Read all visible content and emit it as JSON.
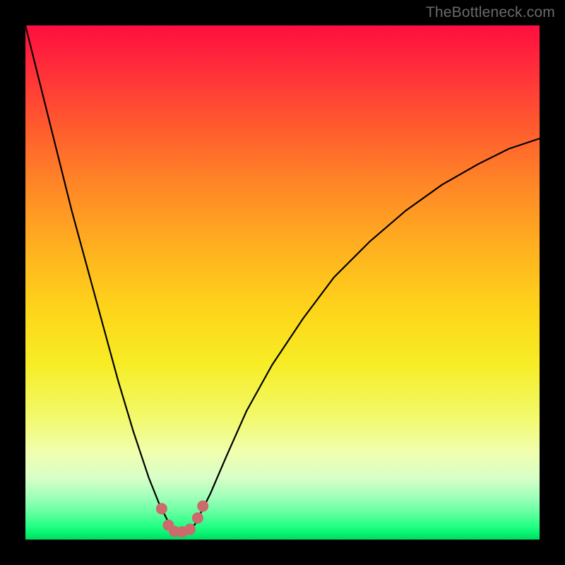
{
  "watermark": "TheBottleneck.com",
  "chart_data": {
    "type": "line",
    "title": "",
    "xlabel": "",
    "ylabel": "",
    "xlim": [
      0,
      100
    ],
    "ylim": [
      0,
      100
    ],
    "grid": false,
    "legend": false,
    "background_gradient": {
      "direction": "vertical",
      "stops": [
        {
          "pos": 0,
          "color": "#FF0E3F",
          "meaning": "high"
        },
        {
          "pos": 50,
          "color": "#FFC81F",
          "meaning": "mid"
        },
        {
          "pos": 100,
          "color": "#02D962",
          "meaning": "low"
        }
      ],
      "note": "y=100 at top (red), y=0 at bottom (green); color encodes bottleneck severity"
    },
    "series": [
      {
        "name": "bottleneck-curve",
        "stroke": "#000000",
        "x": [
          0,
          3,
          6,
          9,
          12,
          15,
          18,
          21,
          24,
          26,
          27,
          28,
          29,
          30,
          31,
          32,
          33,
          34,
          36,
          39,
          43,
          48,
          54,
          60,
          67,
          74,
          81,
          88,
          94,
          100
        ],
        "y": [
          100,
          88,
          76,
          64,
          53,
          42,
          31,
          21,
          12,
          7,
          5,
          3,
          2,
          1.5,
          1.5,
          2,
          3,
          5,
          9,
          16,
          25,
          34,
          43,
          51,
          58,
          64,
          69,
          73,
          76,
          78
        ],
        "note": "values estimated from pixels; minimum (optimum) near x≈30 with y≈1.5"
      },
      {
        "name": "markers",
        "stroke": "none",
        "fill": "#CD6A6C",
        "marker_radius_approx": 1.1,
        "points": [
          {
            "x": 26.5,
            "y": 6.0
          },
          {
            "x": 27.8,
            "y": 2.8
          },
          {
            "x": 29.0,
            "y": 1.6
          },
          {
            "x": 30.5,
            "y": 1.5
          },
          {
            "x": 32.0,
            "y": 2.0
          },
          {
            "x": 33.5,
            "y": 4.2
          },
          {
            "x": 34.5,
            "y": 6.5
          }
        ],
        "note": "small salmon dots clustered at the valley of the curve"
      }
    ]
  }
}
